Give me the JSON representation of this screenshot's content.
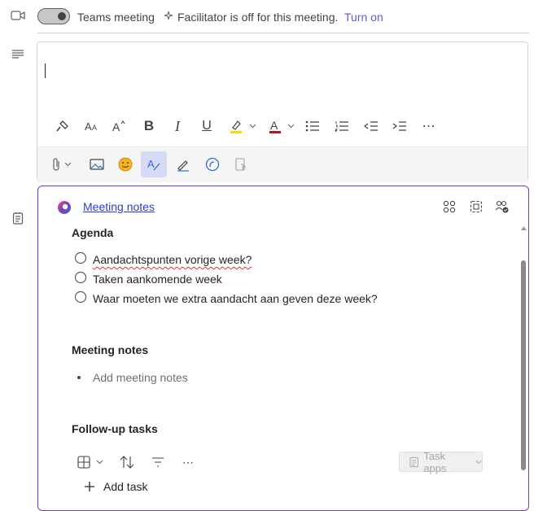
{
  "teams_row": {
    "label": "Teams meeting",
    "facilitator_text": "Facilitator is off for this meeting.",
    "turn_on_label": "Turn on",
    "toggle_state": "off"
  },
  "toolbar": {
    "buttons": [
      "format-painter",
      "font-size",
      "text-effects",
      "bold",
      "italic",
      "underline",
      "highlight",
      "font-color",
      "bullets",
      "numbering",
      "decrease-indent",
      "increase-indent",
      "more"
    ],
    "insert_buttons": [
      "attach",
      "picture",
      "emoji",
      "editor-active",
      "draw",
      "copilot",
      "dictate"
    ]
  },
  "loop_card": {
    "title": "Meeting notes",
    "agenda_heading": "Agenda",
    "agenda_items": [
      "Aandachtspunten vorige week?",
      "Taken aankomende week",
      "Waar moeten we extra aandacht aan geven deze week?"
    ],
    "notes_heading": "Meeting notes",
    "notes_placeholder": "Add meeting notes",
    "followup_heading": "Follow-up tasks",
    "task_apps_label": "Task apps",
    "add_task_label": "Add task"
  },
  "colors": {
    "accent": "#5b5fc7",
    "card_border": "#7b3cc4",
    "link": "#2d3bd1"
  }
}
